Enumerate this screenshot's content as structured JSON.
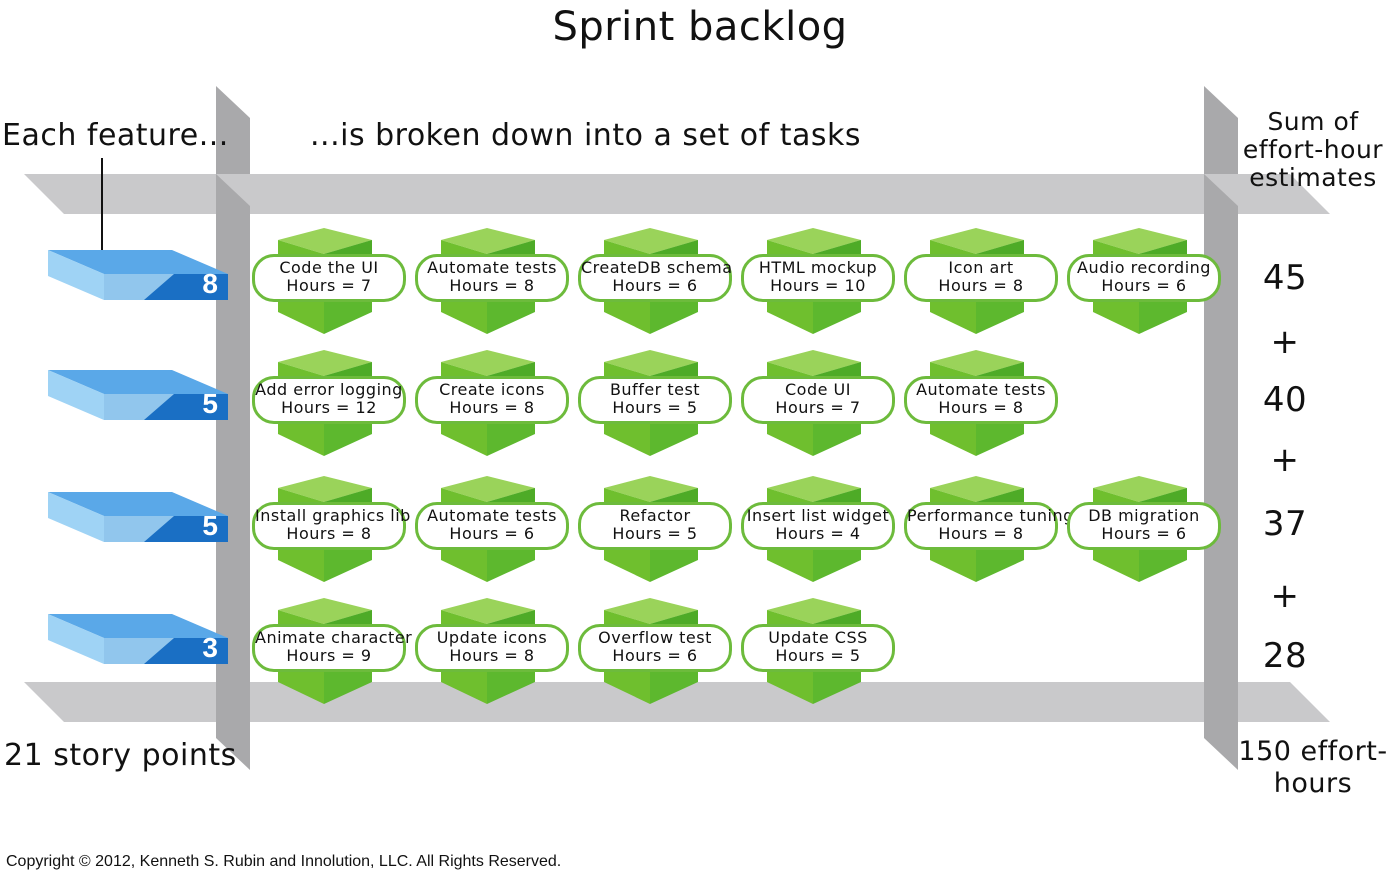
{
  "title": "Sprint backlog",
  "labels": {
    "each_feature": "Each feature...",
    "broken_down": "...is broken down into a set of tasks",
    "sum_header": "Sum of effort-hour estimates",
    "story_points": "21 story points",
    "total_hours": "150 effort-hours",
    "copyright": "Copyright © 2012, Kenneth S. Rubin and Innolution, LLC. All Rights Reserved."
  },
  "colors": {
    "feature_blue": "#1a6fc4",
    "task_green": "#5db82e",
    "pill_border": "#6dbb3c",
    "rail_gray": "#c9c9c9"
  },
  "plus_sign": "+",
  "rows": [
    {
      "points": "8",
      "sum": "45",
      "tasks": [
        {
          "name": "Code the UI",
          "hours": "Hours = 7"
        },
        {
          "name": "Automate tests",
          "hours": "Hours = 8"
        },
        {
          "name": "CreateDB schema",
          "hours": "Hours = 6"
        },
        {
          "name": "HTML mockup",
          "hours": "Hours = 10"
        },
        {
          "name": "Icon art",
          "hours": "Hours = 8"
        },
        {
          "name": "Audio recording",
          "hours": "Hours = 6"
        }
      ]
    },
    {
      "points": "5",
      "sum": "40",
      "tasks": [
        {
          "name": "Add error logging",
          "hours": "Hours = 12"
        },
        {
          "name": "Create icons",
          "hours": "Hours = 8"
        },
        {
          "name": "Buffer test",
          "hours": "Hours = 5"
        },
        {
          "name": "Code UI",
          "hours": "Hours = 7"
        },
        {
          "name": "Automate tests",
          "hours": "Hours = 8"
        }
      ]
    },
    {
      "points": "5",
      "sum": "37",
      "tasks": [
        {
          "name": "Install graphics lib",
          "hours": "Hours = 8"
        },
        {
          "name": "Automate tests",
          "hours": "Hours = 6"
        },
        {
          "name": "Refactor",
          "hours": "Hours = 5"
        },
        {
          "name": "Insert list widget",
          "hours": "Hours = 4"
        },
        {
          "name": "Performance tuning",
          "hours": "Hours = 8"
        },
        {
          "name": "DB migration",
          "hours": "Hours = 6"
        }
      ]
    },
    {
      "points": "3",
      "sum": "28",
      "tasks": [
        {
          "name": "Animate character",
          "hours": "Hours = 9"
        },
        {
          "name": "Update icons",
          "hours": "Hours = 8"
        },
        {
          "name": "Overflow test",
          "hours": "Hours = 6"
        },
        {
          "name": "Update CSS",
          "hours": "Hours = 5"
        }
      ]
    }
  ]
}
